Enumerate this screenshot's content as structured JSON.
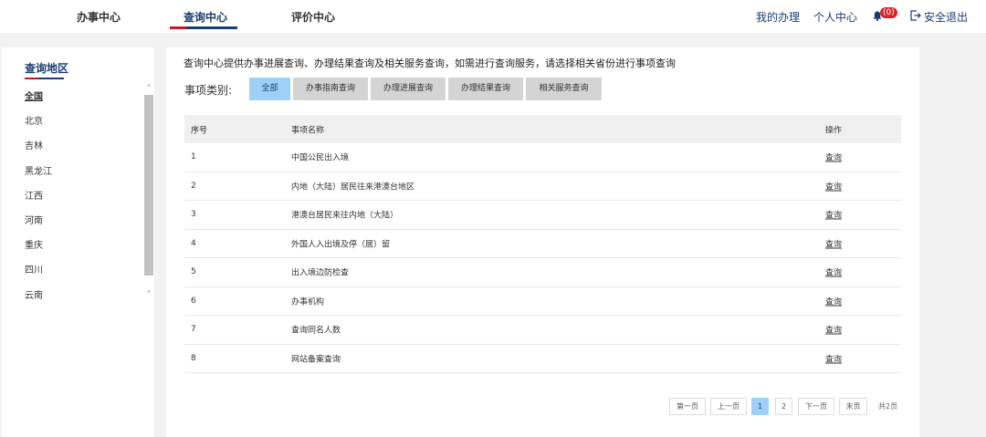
{
  "header": {
    "tabs": [
      {
        "label": "办事中心"
      },
      {
        "label": "查询中心"
      },
      {
        "label": "评价中心"
      }
    ],
    "my_business": "我的办理",
    "personal_center": "个人中心",
    "notification_count": "(0)",
    "logout": "安全退出",
    "accent_color": "#1a3c74",
    "accent_red": "#c8171e"
  },
  "sidebar": {
    "title": "查询地区",
    "regions": [
      "全国",
      "北京",
      "吉林",
      "黑龙江",
      "江西",
      "河南",
      "重庆",
      "四川",
      "云南"
    ]
  },
  "main": {
    "intro": "查询中心提供办事进展查询、办理结果查询及相关服务查询，如需进行查询服务，请选择相关省份进行事项查询",
    "category_label": "事项类别:",
    "categories": [
      "全部",
      "办事指南查询",
      "办理进展查询",
      "办理结果查询",
      "相关服务查询"
    ],
    "table": {
      "headers": {
        "index": "序号",
        "name": "事项名称",
        "action": "操作"
      },
      "rows": [
        {
          "index": "1",
          "name": "中国公民出入境",
          "action": "查询"
        },
        {
          "index": "2",
          "name": "内地（大陆）居民往来港澳台地区",
          "action": "查询"
        },
        {
          "index": "3",
          "name": "港澳台居民来往内地（大陆）",
          "action": "查询"
        },
        {
          "index": "4",
          "name": "外国人入出境及停（居）留",
          "action": "查询"
        },
        {
          "index": "5",
          "name": "出入境边防检查",
          "action": "查询"
        },
        {
          "index": "6",
          "name": "办事机构",
          "action": "查询"
        },
        {
          "index": "7",
          "name": "查询同名人数",
          "action": "查询"
        },
        {
          "index": "8",
          "name": "网站备案查询",
          "action": "查询"
        }
      ]
    },
    "pagination": {
      "first": "第一页",
      "prev": "上一页",
      "page1": "1",
      "page2": "2",
      "next": "下一页",
      "last": "末页",
      "total": "共2页"
    }
  }
}
